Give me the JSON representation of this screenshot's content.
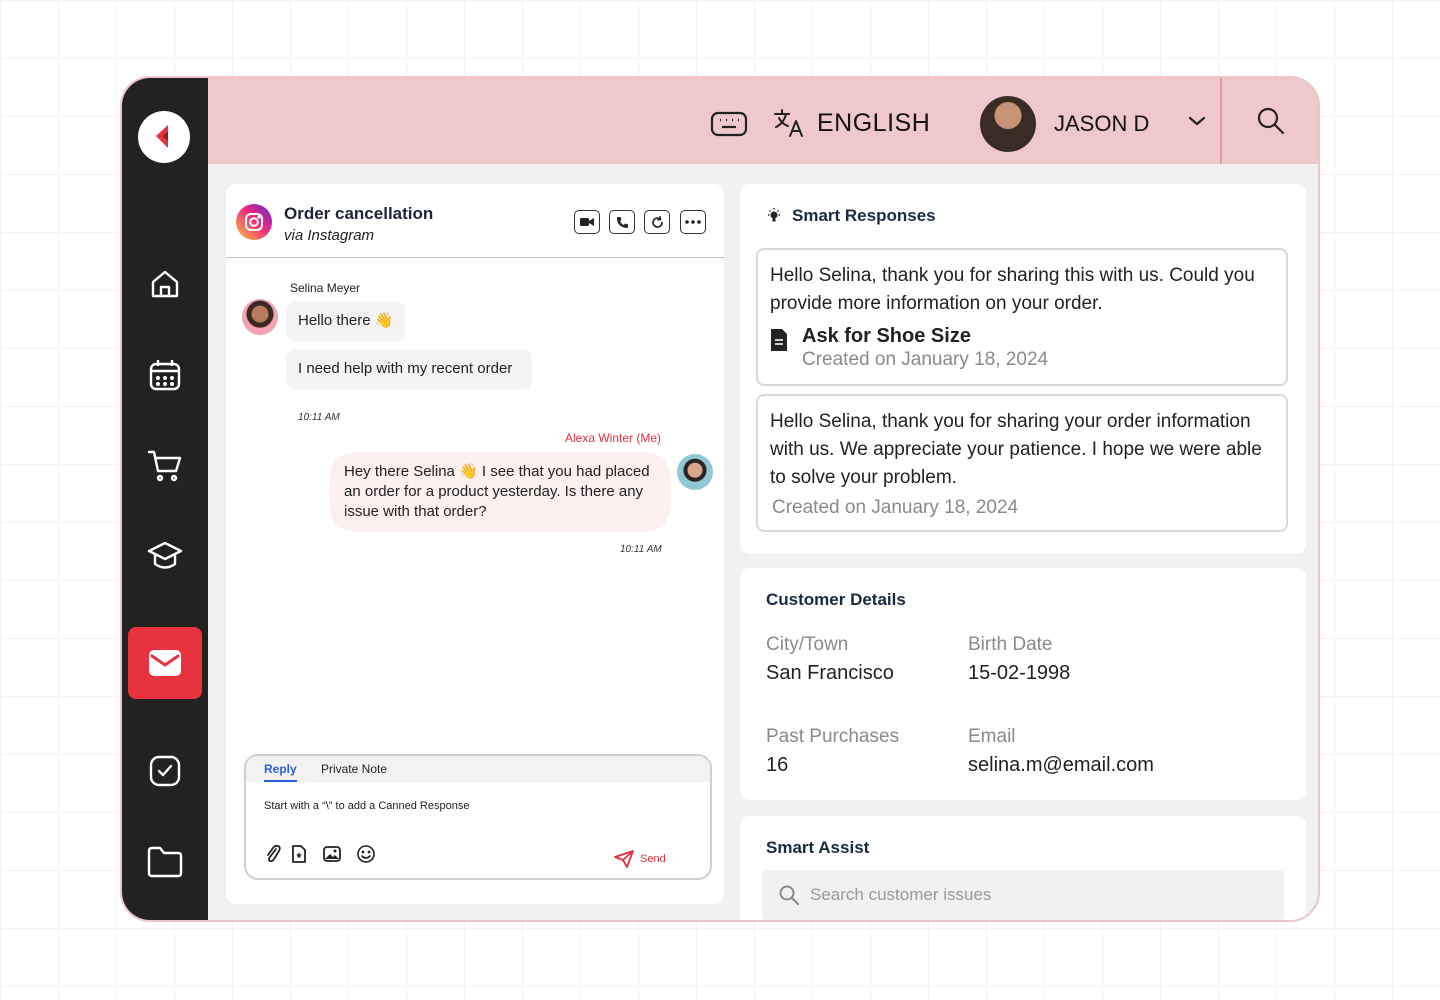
{
  "header": {
    "language": "ENGLISH",
    "user_name": "JASON D"
  },
  "chat": {
    "title": "Order cancellation",
    "channel": "via Instagram",
    "messages": [
      {
        "sender": "Selina Meyer",
        "lines": [
          "Hello there 👋",
          "I need help with my recent order"
        ],
        "time": "10:11 AM"
      },
      {
        "sender": "Alexa Winter (Me)",
        "text": "Hey there Selina 👋 I see that you had placed an order for a product yesterday. Is there any issue with that order?",
        "time": "10:11 AM"
      }
    ],
    "composer": {
      "tab_reply": "Reply",
      "tab_private": "Private Note",
      "hint": "Start with a “\\” to add a Canned Response",
      "send_label": "Send"
    }
  },
  "smart_responses": {
    "title": "Smart Responses",
    "items": [
      {
        "text": "Hello Selina, thank you for sharing this with us. Could you provide more information on your order.",
        "doc_title": "Ask for Shoe Size",
        "date": "Created on January 18, 2024"
      },
      {
        "text": "Hello Selina, thank you for sharing your order information with us. We appreciate your patience. I hope we were able to solve your problem.",
        "date": "Created on January 18, 2024"
      }
    ]
  },
  "customer_details": {
    "title": "Customer Details",
    "city_label": "City/Town",
    "city": "San Francisco",
    "birth_label": "Birth Date",
    "birth": "15-02-1998",
    "purchases_label": "Past Purchases",
    "purchases": "16",
    "email_label": "Email",
    "email": "selina.m@email.com"
  },
  "smart_assist": {
    "title": "Smart Assist",
    "search_placeholder": "Search customer issues"
  },
  "colors": {
    "accent": "#e8323f",
    "topbar": "#efc8cc",
    "sidebar": "#222222"
  }
}
